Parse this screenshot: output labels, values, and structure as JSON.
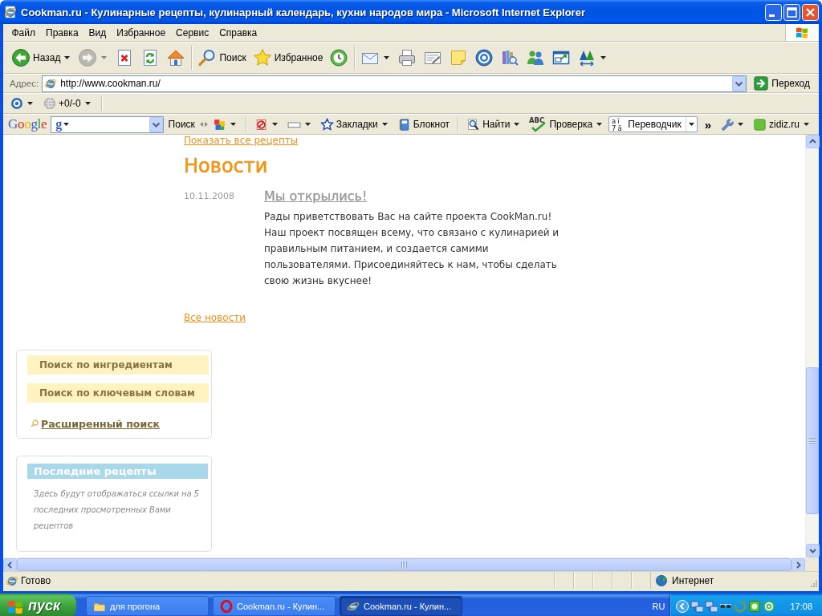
{
  "window": {
    "title": "Cookman.ru - Кулинарные рецепты, кулинарный календарь, кухни народов мира - Microsoft Internet Explorer"
  },
  "menu_bar": {
    "items": [
      "Файл",
      "Правка",
      "Вид",
      "Избранное",
      "Сервис",
      "Справка"
    ]
  },
  "standard_toolbar": {
    "groups": [
      [
        {
          "kind": "back",
          "label": "Назад",
          "dropdown": true,
          "disabled": false
        },
        {
          "kind": "forward",
          "dropdown": true,
          "disabled": true
        },
        {
          "kind": "stop",
          "dropdown": false,
          "disabled": false
        },
        {
          "kind": "refresh",
          "dropdown": false,
          "disabled": false
        },
        {
          "kind": "home",
          "dropdown": false,
          "disabled": false
        }
      ],
      [
        {
          "kind": "search",
          "label": "Поиск",
          "dropdown": false,
          "disabled": false
        },
        {
          "kind": "favorites",
          "label": "Избранное",
          "dropdown": false,
          "disabled": false
        },
        {
          "kind": "history",
          "dropdown": false,
          "disabled": false
        }
      ],
      [
        {
          "kind": "mail",
          "dropdown": true,
          "disabled": false
        },
        {
          "kind": "print",
          "dropdown": false,
          "disabled": false
        },
        {
          "kind": "edit",
          "dropdown": false,
          "disabled": false
        },
        {
          "kind": "note",
          "dropdown": false,
          "disabled": false
        },
        {
          "kind": "disc",
          "dropdown": false,
          "disabled": false
        },
        {
          "kind": "research",
          "dropdown": false,
          "disabled": false
        },
        {
          "kind": "people",
          "dropdown": false,
          "disabled": false
        },
        {
          "kind": "window",
          "dropdown": false,
          "disabled": false
        },
        {
          "kind": "font",
          "dropdown": true,
          "disabled": false
        }
      ]
    ]
  },
  "address_bar": {
    "label": "Адрес:",
    "value": "http://www.cookman.ru/",
    "go": "Переход"
  },
  "links_bar": {
    "items": [
      {
        "kind": "target",
        "dropdown": true
      },
      {
        "kind": "globe",
        "label": "+0/-0",
        "dropdown": true
      }
    ]
  },
  "google_bar": {
    "logo": "Google",
    "engine": "g",
    "search": "Поиск",
    "groups": [
      [
        {
          "kind": "blocks",
          "dropdown": true,
          "pressed": false
        }
      ],
      [
        {
          "kind": "blocked",
          "dropdown": true,
          "pressed": false
        },
        {
          "kind": "frame",
          "dropdown": true,
          "pressed": false
        },
        {
          "kind": "star",
          "label": "Закладки",
          "dropdown": true,
          "pressed": false
        },
        {
          "kind": "notebook",
          "label": "Блокнот",
          "dropdown": false,
          "pressed": false
        }
      ],
      [
        {
          "kind": "find",
          "label": "Найти",
          "dropdown": true,
          "pressed": false
        },
        {
          "kind": "spellcheck",
          "label": "Проверка",
          "icon_rows": [
            "ABC"
          ],
          "dropdown": true,
          "pressed": false
        },
        {
          "kind": "translate",
          "label": "Переводчик",
          "icon_rows": [
            "aĭ",
            "7ä"
          ],
          "dropdown": true,
          "pressed": true
        }
      ]
    ],
    "more": "»",
    "right": [
      {
        "kind": "wrench",
        "dropdown": true,
        "pressed": false
      },
      {
        "kind": "square",
        "label": "zidiz.ru",
        "dropdown": true,
        "pressed": false
      }
    ]
  },
  "page": {
    "recipes_link": "Показать все рецепты",
    "news": {
      "heading": "Новости",
      "items": [
        {
          "date": "10.11.2008",
          "title": "Мы открылись!",
          "text": "Рады приветствовать Вас на сайте проекта CookMan.ru! Наш проект посвящен всему, что связано с кулинарией и правильным питанием, и создается самими пользователями. Присоединяйтесь к нам, чтобы сделать свою жизнь вкуснее!"
        }
      ],
      "all_link": "Все новости"
    },
    "search_panel": {
      "tabs": [
        "Поиск по ингредиентам",
        "Поиск по ключевым словам"
      ],
      "advanced_link": "Расширенный поиск"
    },
    "recent_panel": {
      "heading": "Последние рецепты",
      "text": "Здесь будут отображаться ссылки на 5 последних просмотренных Вами рецептов"
    }
  },
  "status_bar": {
    "text": "Готово",
    "zone": "Интернет"
  },
  "taskbar": {
    "start": "пуск",
    "tasks": [
      {
        "kind": "folder",
        "label": "для прогона",
        "selected": false
      },
      {
        "kind": "opera",
        "label": "Cookman.ru - Кулин...",
        "selected": false
      },
      {
        "kind": "ie",
        "label": "Cookman.ru - Кулин...",
        "selected": true
      }
    ],
    "language": "RU",
    "clock": "17:08"
  }
}
